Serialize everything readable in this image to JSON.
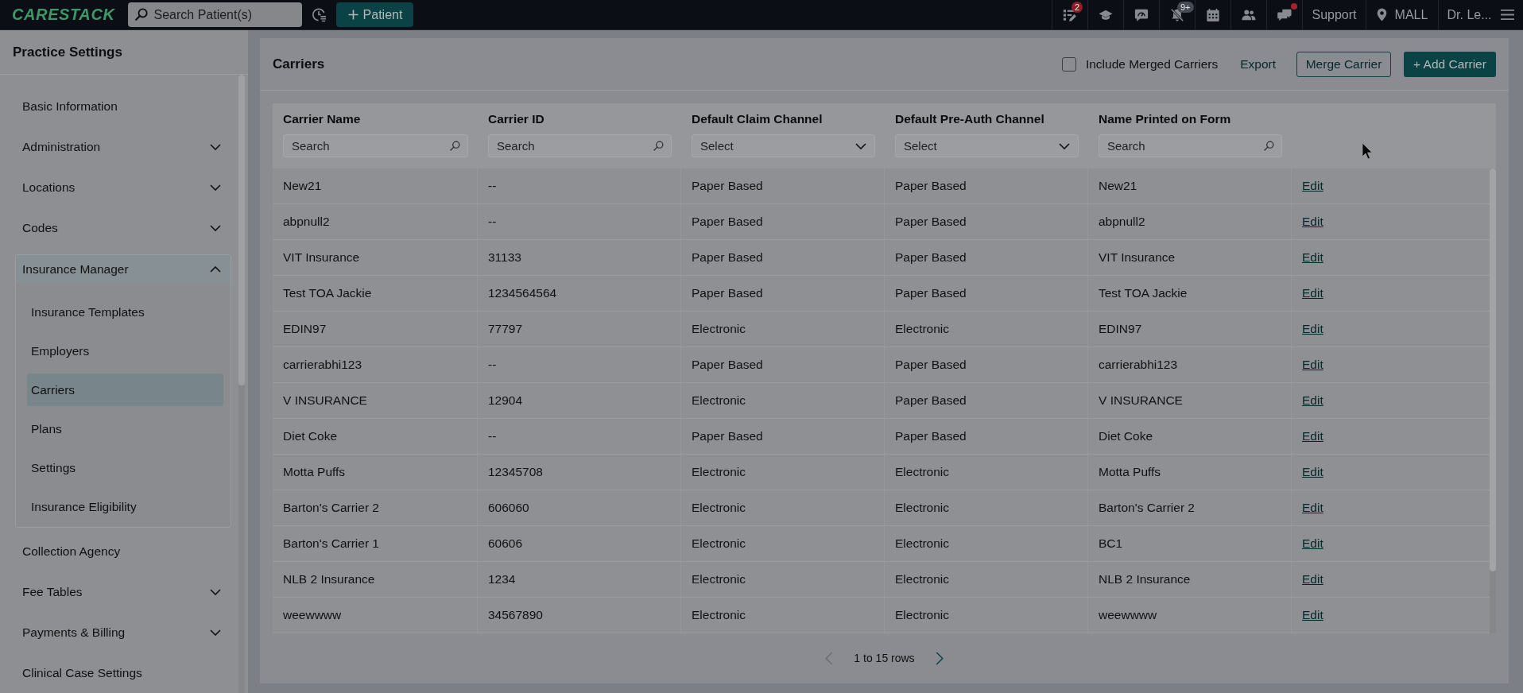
{
  "top_bar": {
    "logo": "CARESTACK",
    "search": {
      "placeholder": "Search Patient(s)"
    },
    "patient_button": "Patient",
    "tasks_badge": "2",
    "alerts_badge": "9+",
    "messages_unread": true,
    "support_link": "Support",
    "location": "MALL",
    "user": "Dr. Le..."
  },
  "sidebar": {
    "title": "Practice Settings",
    "items": [
      {
        "label": "Basic Information",
        "kind": "page",
        "selected": false
      },
      {
        "label": "Administration",
        "kind": "group",
        "selected": false,
        "expanded": false
      },
      {
        "label": "Locations",
        "kind": "group",
        "selected": false,
        "expanded": false
      },
      {
        "label": "Codes",
        "kind": "group",
        "selected": false,
        "expanded": false
      },
      {
        "label": "Insurance Manager",
        "kind": "group",
        "selected": false,
        "expanded": true,
        "children": [
          {
            "label": "Insurance Templates",
            "selected": false
          },
          {
            "label": "Employers",
            "selected": false
          },
          {
            "label": "Carriers",
            "selected": true
          },
          {
            "label": "Plans",
            "selected": false
          },
          {
            "label": "Settings",
            "selected": false
          },
          {
            "label": "Insurance Eligibility",
            "selected": false
          }
        ]
      },
      {
        "label": "Collection Agency",
        "kind": "page",
        "selected": false
      },
      {
        "label": "Fee Tables",
        "kind": "group",
        "selected": false,
        "expanded": false
      },
      {
        "label": "Payments & Billing",
        "kind": "group",
        "selected": false,
        "expanded": false
      },
      {
        "label": "Clinical Case Settings",
        "kind": "page",
        "selected": false
      }
    ]
  },
  "carriers": {
    "title": "Carriers",
    "include_merged": {
      "label": "Include Merged Carriers",
      "checked": false
    },
    "export_link": "Export",
    "merge_button": "Merge Carrier",
    "add_button": "+ Add Carrier",
    "table": {
      "columns": [
        {
          "label": "Carrier Name",
          "filter": {
            "kind": "search",
            "placeholder": "Search"
          }
        },
        {
          "label": "Carrier ID",
          "filter": {
            "kind": "search",
            "placeholder": "Search"
          }
        },
        {
          "label": "Default Claim Channel",
          "filter": {
            "kind": "select",
            "placeholder": "Select"
          }
        },
        {
          "label": "Default Pre-Auth Channel",
          "filter": {
            "kind": "select",
            "placeholder": "Select"
          }
        },
        {
          "label": "Name Printed on Form",
          "filter": {
            "kind": "search",
            "placeholder": "Search"
          }
        }
      ],
      "rows": [
        {
          "cells": [
            "New21",
            "--",
            "Paper Based",
            "Paper Based",
            "New21"
          ],
          "action": "Edit"
        },
        {
          "cells": [
            "abpnull2",
            "--",
            "Paper Based",
            "Paper Based",
            "abpnull2"
          ],
          "action": "Edit"
        },
        {
          "cells": [
            "VIT Insurance",
            "31133",
            "Paper Based",
            "Paper Based",
            "VIT Insurance"
          ],
          "action": "Edit"
        },
        {
          "cells": [
            "Test TOA Jackie",
            "1234564564",
            "Paper Based",
            "Paper Based",
            "Test TOA Jackie"
          ],
          "action": "Edit"
        },
        {
          "cells": [
            "EDIN97",
            "77797",
            "Electronic",
            "Electronic",
            "EDIN97"
          ],
          "action": "Edit"
        },
        {
          "cells": [
            "carrierabhi123",
            "--",
            "Paper Based",
            "Paper Based",
            "carrierabhi123"
          ],
          "action": "Edit"
        },
        {
          "cells": [
            "V INSURANCE",
            "12904",
            "Electronic",
            "Paper Based",
            "V INSURANCE"
          ],
          "action": "Edit"
        },
        {
          "cells": [
            "Diet Coke",
            "--",
            "Paper Based",
            "Paper Based",
            "Diet Coke"
          ],
          "action": "Edit"
        },
        {
          "cells": [
            "Motta Puffs",
            "12345708",
            "Electronic",
            "Electronic",
            "Motta Puffs"
          ],
          "action": "Edit"
        },
        {
          "cells": [
            "Barton's Carrier 2",
            "606060",
            "Electronic",
            "Electronic",
            "Barton's Carrier 2"
          ],
          "action": "Edit"
        },
        {
          "cells": [
            "Barton's Carrier 1",
            "60606",
            "Electronic",
            "Electronic",
            "BC1"
          ],
          "action": "Edit"
        },
        {
          "cells": [
            "NLB 2 Insurance",
            "1234",
            "Electronic",
            "Electronic",
            "NLB 2 Insurance"
          ],
          "action": "Edit"
        },
        {
          "cells": [
            "weewwww",
            "34567890",
            "Electronic",
            "Electronic",
            "weewwww"
          ],
          "action": "Edit"
        }
      ]
    },
    "pagination": {
      "summary": "1 to 15 rows",
      "prev_disabled": true,
      "next_disabled": false
    }
  }
}
